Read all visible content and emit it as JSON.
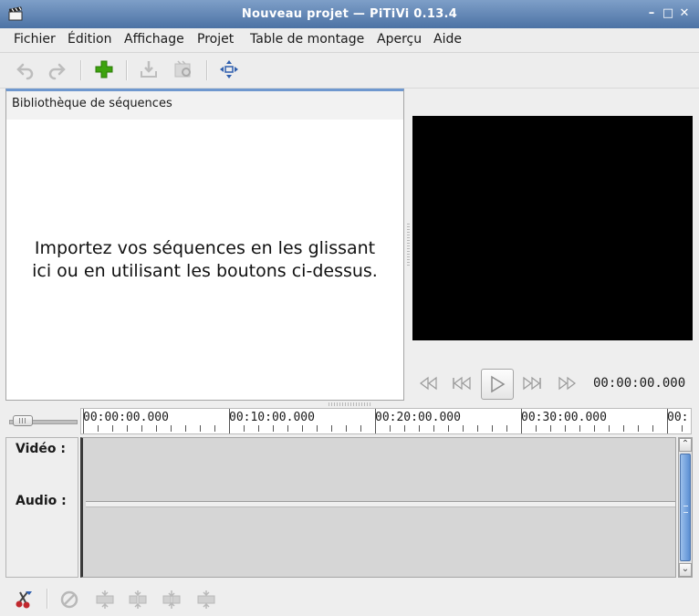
{
  "window": {
    "title": "Nouveau projet — PiTiVi 0.13.4"
  },
  "menu": {
    "items": [
      "Fichier",
      "Édition",
      "Affichage",
      "Projet",
      "Table de montage",
      "Aperçu",
      "Aide"
    ]
  },
  "library": {
    "title": "Bibliothèque de séquences",
    "message_line1": "Importez vos séquences en les glissant",
    "message_line2": "ici ou en utilisant les boutons ci-dessus."
  },
  "playback": {
    "timecode": "00:00:00.000"
  },
  "ruler": {
    "labels": [
      "00:00:00.000",
      "00:10:00.000",
      "00:20:00.000",
      "00:30:00.000",
      "00:"
    ]
  },
  "tracks": {
    "video_label": "Vidéo :",
    "audio_label": "Audio :"
  },
  "zoom": {
    "level": 0.1
  },
  "colors": {
    "accent": "#6f98cf",
    "viewer_bg": "#000000",
    "add_green": "#3da30e",
    "titlebar": "#5e83b4"
  }
}
